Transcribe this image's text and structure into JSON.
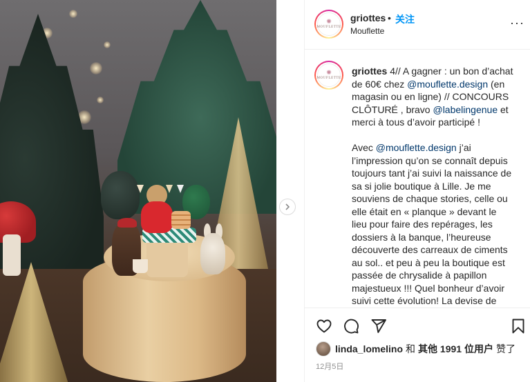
{
  "post": {
    "username": "griottes",
    "dot": "•",
    "follow_label": "关注",
    "location": "Mouflette",
    "more_label": "···",
    "logo_text": "MOUFLETTE"
  },
  "caption": {
    "author": "griottes",
    "p1_a": " 4// A gagner : un bon d’achat de 60€ chez ",
    "p1_mention1": "@mouflette.design",
    "p1_b": " (en magasin ou en ligne) // CONCOURS CLÔTURÉ , bravo ",
    "p1_mention2": "@labelingenue",
    "p1_c": " et merci à tous d’avoir participé !",
    "p2_a": "Avec ",
    "p2_mention": "@mouflette.design",
    "p2_b": " j’ai l’impression qu’on se connaît depuis toujours tant j’ai suivi la naissance de sa si jolie boutique à Lille. Je me souviens de chaque stories, celle ou elle était en « planque » devant le lieu pour faire des repérages, les dossiers à la banque, l’heureuse découverte des carreaux de ciments au sol.. et peu à peu la boutique est passée de chrysalide à papillon majestueux !!! Quel bonheur d’avoir suivi cette évolution! La devise de Mouflette : pour l’enfant qui vit en toi! Et c’est"
  },
  "likes": {
    "user": "linda_lomelino",
    "and": "和",
    "others": "其他 1991 位用户",
    "liked": "赞了"
  },
  "date": "12月5日",
  "icons": [
    "heart-icon",
    "comment-icon",
    "share-icon",
    "bookmark-icon",
    "chevron-right-icon",
    "more-icon"
  ],
  "colors": {
    "accent": "#0095f6",
    "mention": "#00376b",
    "muted": "#8e8e8e"
  }
}
